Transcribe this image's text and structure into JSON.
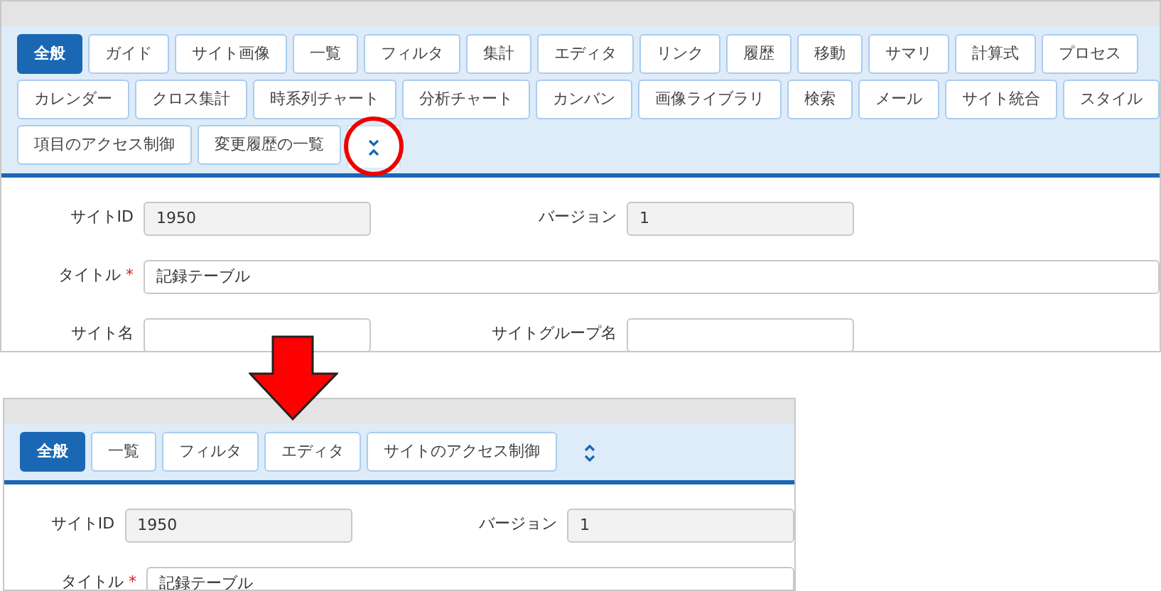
{
  "panels": [
    {
      "tabs": [
        {
          "label": "全般",
          "selected": true
        },
        {
          "label": "ガイド",
          "selected": false
        },
        {
          "label": "サイト画像",
          "selected": false
        },
        {
          "label": "一覧",
          "selected": false
        },
        {
          "label": "フィルタ",
          "selected": false
        },
        {
          "label": "集計",
          "selected": false
        },
        {
          "label": "エディタ",
          "selected": false
        },
        {
          "label": "リンク",
          "selected": false
        },
        {
          "label": "履歴",
          "selected": false
        },
        {
          "label": "移動",
          "selected": false
        },
        {
          "label": "サマリ",
          "selected": false
        },
        {
          "label": "計算式",
          "selected": false
        },
        {
          "label": "プロセス",
          "selected": false
        },
        {
          "label": "カレンダー",
          "selected": false
        },
        {
          "label": "クロス集計",
          "selected": false
        },
        {
          "label": "時系列チャート",
          "selected": false
        },
        {
          "label": "分析チャート",
          "selected": false
        },
        {
          "label": "カンバン",
          "selected": false
        },
        {
          "label": "画像ライブラリ",
          "selected": false
        },
        {
          "label": "検索",
          "selected": false
        },
        {
          "label": "メール",
          "selected": false
        },
        {
          "label": "サイト統合",
          "selected": false
        },
        {
          "label": "スタイル",
          "selected": false
        },
        {
          "label": "項目のアクセス制御",
          "selected": false
        },
        {
          "label": "変更履歴の一覧",
          "selected": false
        }
      ],
      "toggle": {
        "expanded": true,
        "highlighted": true
      },
      "rows": [
        [
          {
            "label": "サイトID",
            "value": "1950",
            "readonly": true
          },
          {
            "label": "バージョン",
            "value": "1",
            "readonly": true
          }
        ],
        [
          {
            "label": "タイトル",
            "value": "記録テーブル",
            "required_mark": "*",
            "wide": true
          }
        ],
        [
          {
            "label": "サイト名"
          },
          {
            "label": "サイトグループ名"
          }
        ]
      ]
    },
    {
      "tabs": [
        {
          "label": "全般",
          "selected": true
        },
        {
          "label": "一覧",
          "selected": false
        },
        {
          "label": "フィルタ",
          "selected": false
        },
        {
          "label": "エディタ",
          "selected": false
        },
        {
          "label": "サイトのアクセス制御",
          "selected": false
        }
      ],
      "toggle": {
        "expanded": false,
        "highlighted": false
      },
      "rows": [
        [
          {
            "label": "サイトID",
            "value": "1950",
            "readonly": true
          },
          {
            "label": "バージョン",
            "value": "1",
            "readonly": true
          }
        ],
        [
          {
            "label": "タイトル",
            "value": "記録テーブル",
            "required_mark": "*",
            "wide": true
          }
        ]
      ]
    }
  ]
}
